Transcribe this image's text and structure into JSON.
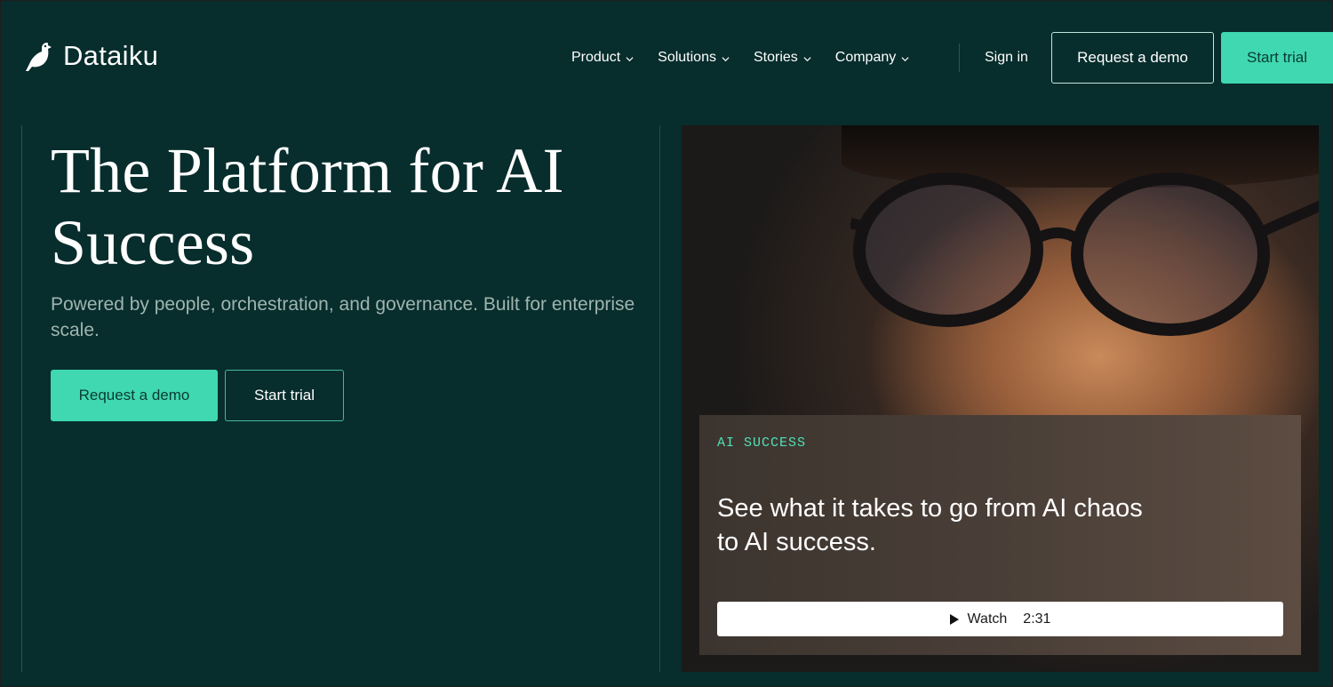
{
  "brand": {
    "name": "Dataiku",
    "accent": "#3fd8b0",
    "background": "#072d2c"
  },
  "nav": {
    "items": [
      {
        "label": "Product"
      },
      {
        "label": "Solutions"
      },
      {
        "label": "Stories"
      },
      {
        "label": "Company"
      }
    ],
    "sign_in": "Sign in",
    "request_demo": "Request a demo",
    "start_trial": "Start trial"
  },
  "hero": {
    "title": "The Platform for AI Success",
    "subtitle": "Powered by people, orchestration, and governance. Built for enterprise scale.",
    "request_demo": "Request a demo",
    "start_trial": "Start trial"
  },
  "video_card": {
    "eyebrow": "AI SUCCESS",
    "title": "See what it takes to go from AI chaos to AI success.",
    "watch_label": "Watch",
    "duration": "2:31"
  },
  "icons": [
    "dataiku-bird-logo-icon",
    "chevron-down-icon",
    "play-icon"
  ]
}
